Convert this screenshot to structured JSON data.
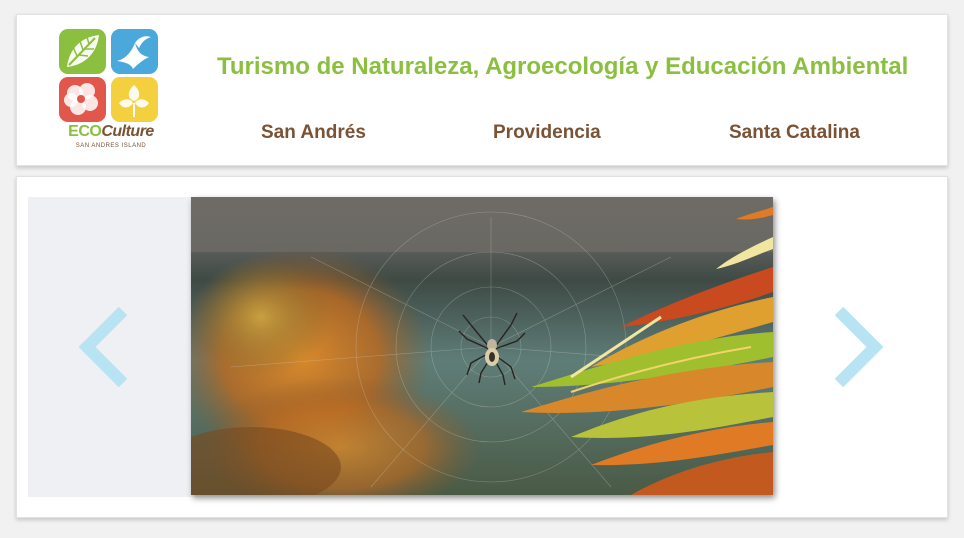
{
  "header": {
    "logo": {
      "brand_eco": "ECO",
      "brand_culture": "Culture",
      "subtitle": "SAN ANDRES ISLAND"
    },
    "title": "Turismo de Naturaleza, Agroecología y Educación Ambiental",
    "nav": [
      {
        "label": "San Andrés"
      },
      {
        "label": "Providencia"
      },
      {
        "label": "Santa Catalina"
      }
    ]
  },
  "carousel": {
    "prev_icon": "chevron-left-icon",
    "next_icon": "chevron-right-icon",
    "slide_subject": "spider-on-web-photo"
  },
  "colors": {
    "accent_green": "#8bbf3f",
    "nav_brown": "#7a5234",
    "arrow_blue": "#b8e3f3",
    "logo_blue": "#4aa8db",
    "logo_red": "#e2574c",
    "logo_yellow": "#f4d03f"
  }
}
